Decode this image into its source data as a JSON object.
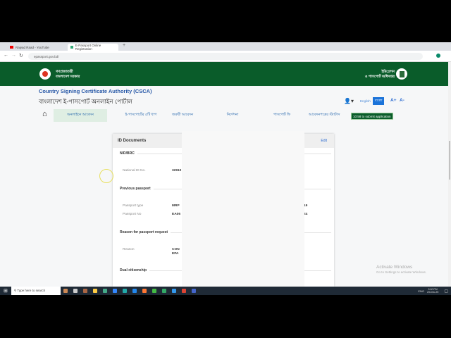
{
  "browser": {
    "tabs": [
      {
        "label": "Raiyad Raad - YouTube"
      },
      {
        "label": "E-Passport Online Registration"
      }
    ],
    "url": "epassport.gov.bd/"
  },
  "banner": {
    "left_text_1": "গণপ্রজাতন্ত্রী",
    "left_text_2": "বাংলাদেশ সরকার",
    "right_text_1": "ইমিগ্রেশন",
    "right_text_2": "ও পাসপোর্ট অধিদপ্তর"
  },
  "header": {
    "csca": "Country Signing Certificate Authority (CSCA)",
    "portal_title": "বাংলাদেশ ই-পাসপোর্ট অনলাইন পোর্টাল",
    "lang_english": "English",
    "lang_bangla": "বাংলা",
    "font_plus": "A+",
    "font_minus": "A-"
  },
  "nav": {
    "items": [
      "অনলাইনে আবেদন",
      "ই-পাসপোর্টের ৫টি ধাপ",
      "জরুরী আবেদন",
      "নির্দেশনা",
      "পাসপোর্ট ফি",
      "আবেদনপত্রের স্ট্যাটাস"
    ],
    "timer": "10:58 to submit application"
  },
  "card": {
    "title": "ID Documents",
    "edit": "Edit",
    "sections": {
      "nid": "NID/BRC",
      "prev": "Previous passport",
      "reason": "Reason for passport request",
      "dual": "Dual citizenship"
    },
    "fields": {
      "nid_label": "National ID No.",
      "nid_value": "32910",
      "ptype_label": "Passport type",
      "ptype_value": "MRP",
      "ptype_right": "19",
      "pno_label": "Passport No",
      "pno_value": "EA06",
      "pno_right": "24",
      "reason_label": "Reason",
      "reason_value_1": "CON",
      "reason_value_2": "EPA"
    }
  },
  "watermark": {
    "line1": "Activate Windows",
    "line2": "Go to Settings to activate Windows."
  },
  "taskbar": {
    "search": "Type here to search",
    "time": "5:00 PM",
    "date": "23-Dec-25",
    "lang": "ENG"
  }
}
